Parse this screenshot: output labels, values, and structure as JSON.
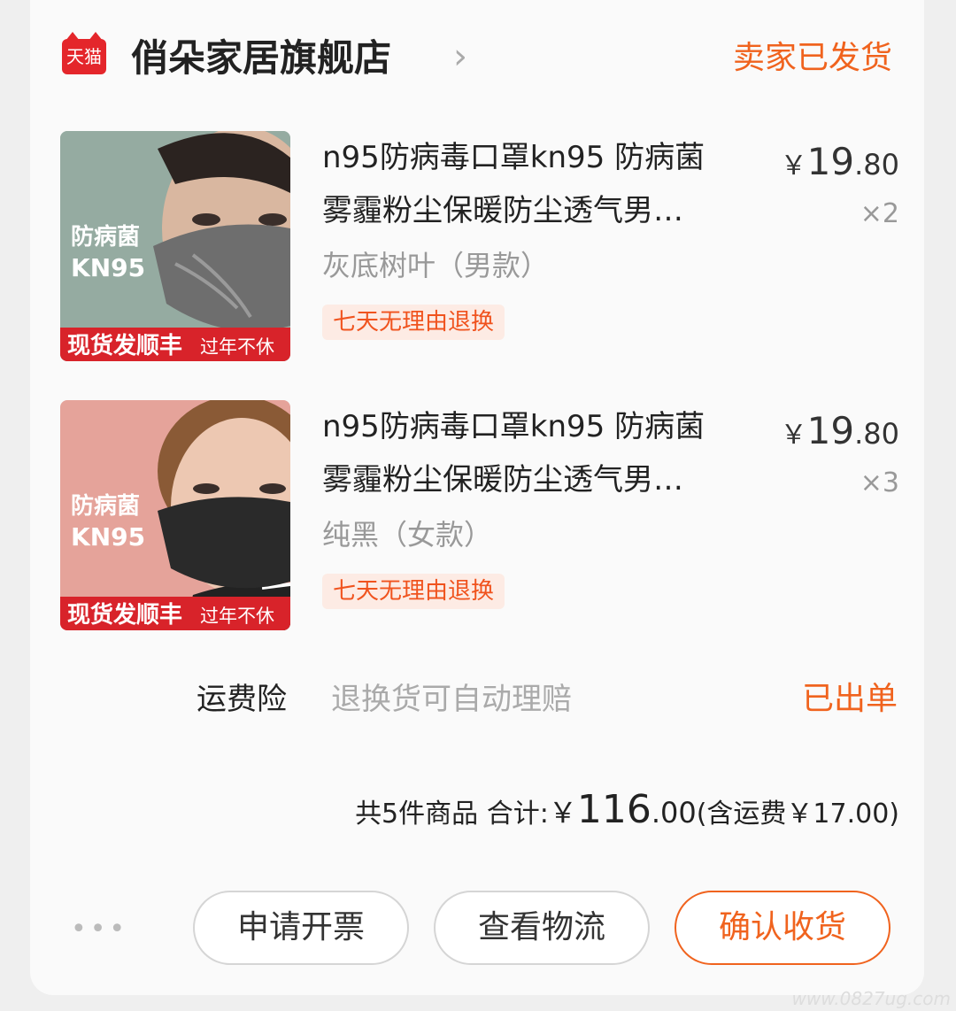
{
  "shop": {
    "badge": "天猫",
    "name": "俏朵家居旗舰店",
    "status": "卖家已发货"
  },
  "products": [
    {
      "title_line1": "n95防病毒口罩kn95 防病菌",
      "title_line2": "雾霾粉尘保暖防尘透气男…",
      "spec": "灰底树叶（男款）",
      "tag": "七天无理由退换",
      "price_currency": "￥",
      "price_int": "19",
      "price_dec": ".80",
      "qty": "×2",
      "image": {
        "text_top": "防病菌",
        "text_bottom": "KN95",
        "banner_main": "现货发顺丰",
        "banner_sub": "过年不休",
        "bg_color": "#8fa59a",
        "mask_color": "#6e6e6e"
      }
    },
    {
      "title_line1": "n95防病毒口罩kn95 防病菌",
      "title_line2": "雾霾粉尘保暖防尘透气男…",
      "spec": "纯黑（女款）",
      "tag": "七天无理由退换",
      "price_currency": "￥",
      "price_int": "19",
      "price_dec": ".80",
      "qty": "×3",
      "image": {
        "text_top": "防病菌",
        "text_bottom": "KN95",
        "banner_main": "现货发顺丰",
        "banner_sub": "过年不休",
        "bg_color": "#e5a39a",
        "mask_color": "#2a2a2a"
      }
    }
  ],
  "insurance": {
    "label": "运费险",
    "desc": "退换货可自动理赔",
    "status": "已出单"
  },
  "summary": {
    "count_text": "共5件商品",
    "total_label": "合计:",
    "currency": "￥",
    "total_int": "116",
    "total_dec": ".00",
    "shipping_text": "(含运费￥17.00)"
  },
  "actions": {
    "more": "•••",
    "invoice": "申请开票",
    "logistics": "查看物流",
    "confirm": "确认收货"
  },
  "watermark": "www.0827ug.com",
  "colors": {
    "accent": "#f0631e",
    "tmall_red": "#e4262b"
  }
}
